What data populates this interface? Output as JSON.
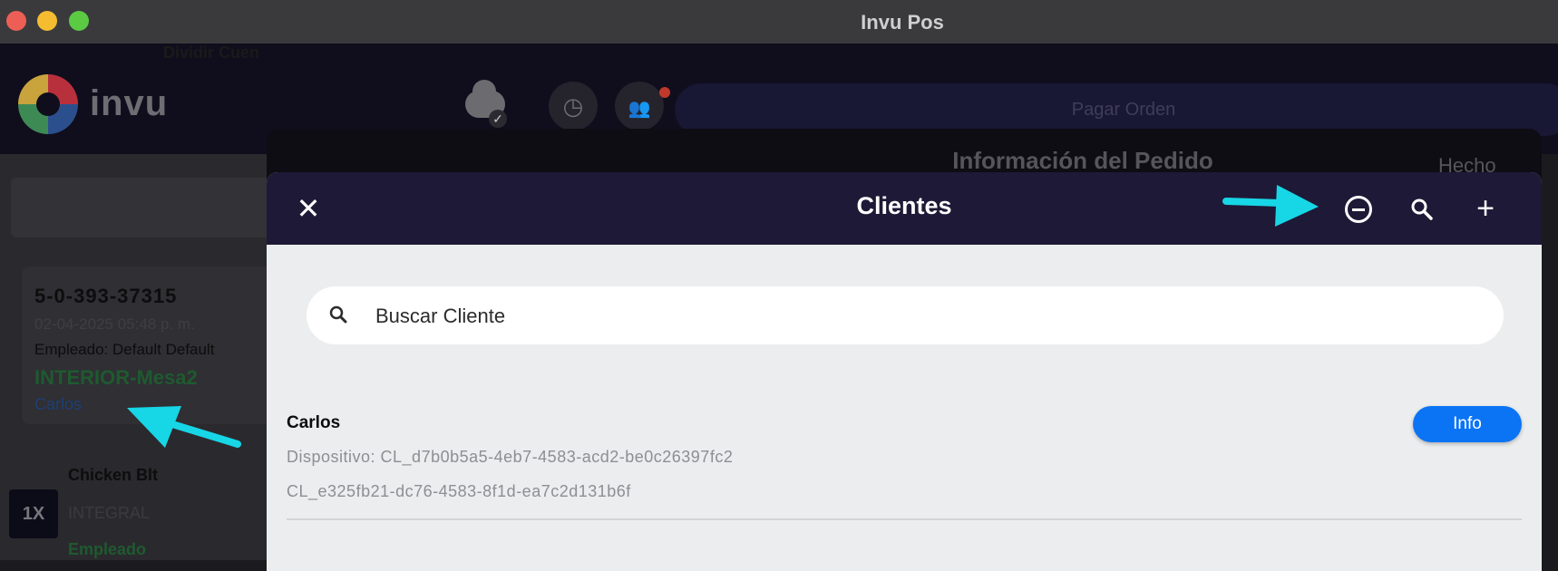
{
  "window": {
    "title": "Invu Pos"
  },
  "app_header": {
    "logo_text": "invu",
    "pay_button_label": "Pagar Orden",
    "icons": [
      "cloud-check-icon",
      "clock-icon",
      "people-icon"
    ]
  },
  "left_panel": {
    "divide_button_label": "Dividir Cuen",
    "order": {
      "number": "5-0-393-37315",
      "date": "02-04-2025 05:48 p. m.",
      "employee": "Empleado: Default Default",
      "table": "INTERIOR-Mesa2",
      "client": "Carlos"
    },
    "item": {
      "quantity": "1X",
      "name": "Chicken Blt",
      "modifier": "INTEGRAL",
      "employee": "Empleado"
    }
  },
  "background_sheet": {
    "title": "Información del Pedido",
    "done_label": "Hecho"
  },
  "clients_modal": {
    "title": "Clientes",
    "close_icon": "close-icon",
    "header_icons": [
      "minus-circle-icon",
      "search-icon",
      "plus-icon"
    ],
    "search": {
      "placeholder": "Buscar Cliente",
      "value": ""
    },
    "clients": [
      {
        "name": "Carlos",
        "device": "Dispositivo: CL_d7b0b5a5-4eb7-4583-acd2-be0c26397fc2",
        "id": "CL_e325fb21-dc76-4583-8f1d-ea7c2d131b6f",
        "info_label": "Info"
      }
    ]
  },
  "colors": {
    "accent_blue": "#0a74f5",
    "modal_header": "#1e1936",
    "annotation_arrow": "#17d6e6"
  }
}
